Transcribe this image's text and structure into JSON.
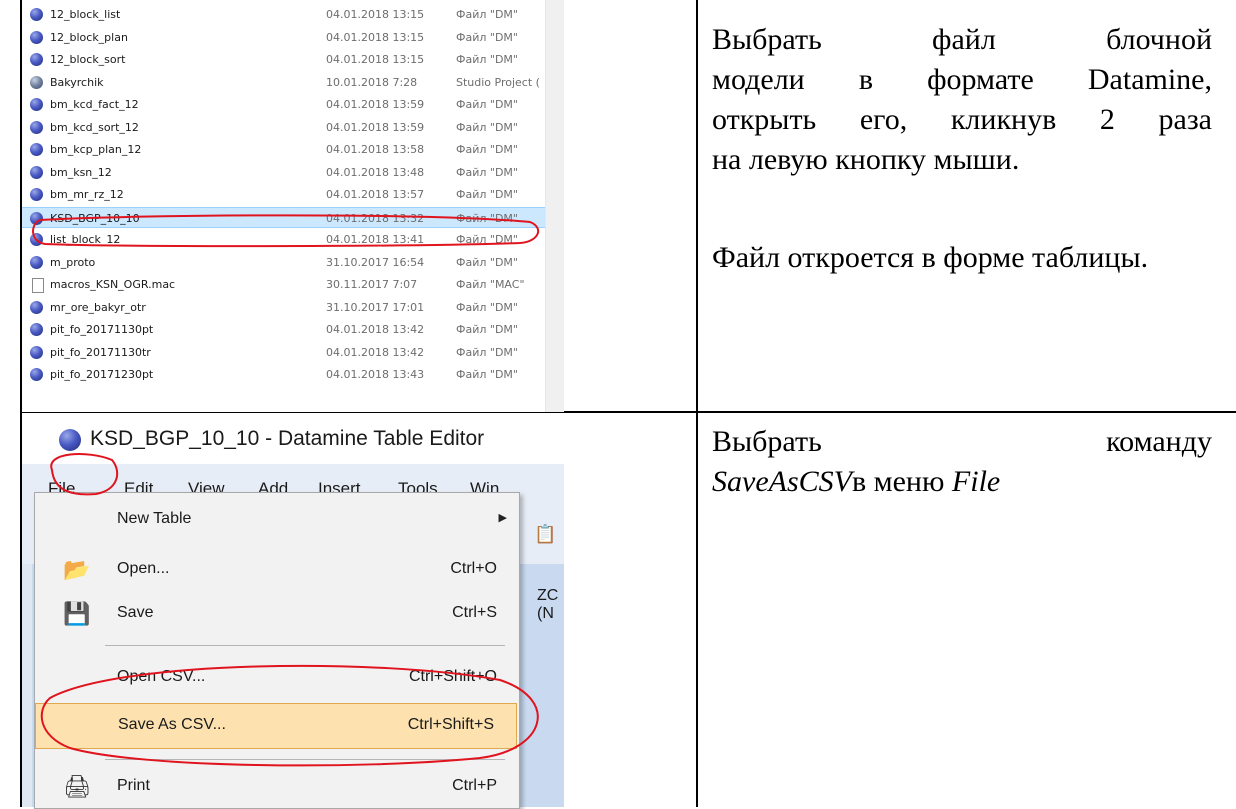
{
  "explorer": {
    "files": [
      {
        "name": "12_block_list",
        "date": "04.01.2018 13:15",
        "type": "Файл \"DM\"",
        "icon": "dm-file-icon"
      },
      {
        "name": "12_block_plan",
        "date": "04.01.2018 13:15",
        "type": "Файл \"DM\"",
        "icon": "dm-file-icon"
      },
      {
        "name": "12_block_sort",
        "date": "04.01.2018 13:15",
        "type": "Файл \"DM\"",
        "icon": "dm-file-icon"
      },
      {
        "name": "Bakyrchik",
        "date": "10.01.2018 7:28",
        "type": "Studio Project (",
        "icon": "studio-project-icon"
      },
      {
        "name": "bm_kcd_fact_12",
        "date": "04.01.2018 13:59",
        "type": "Файл \"DM\"",
        "icon": "dm-file-icon"
      },
      {
        "name": "bm_kcd_sort_12",
        "date": "04.01.2018 13:59",
        "type": "Файл \"DM\"",
        "icon": "dm-file-icon"
      },
      {
        "name": "bm_kcp_plan_12",
        "date": "04.01.2018 13:58",
        "type": "Файл \"DM\"",
        "icon": "dm-file-icon"
      },
      {
        "name": "bm_ksn_12",
        "date": "04.01.2018 13:48",
        "type": "Файл \"DM\"",
        "icon": "dm-file-icon"
      },
      {
        "name": "bm_mr_rz_12",
        "date": "04.01.2018 13:57",
        "type": "Файл \"DM\"",
        "icon": "dm-file-icon"
      },
      {
        "name": "KSD_BGP_10_10",
        "date": "04.01.2018 13:32",
        "type": "Файл \"DM\"",
        "icon": "dm-file-icon",
        "selected": true
      },
      {
        "name": "list_block_12",
        "date": "04.01.2018 13:41",
        "type": "Файл \"DM\"",
        "icon": "dm-file-icon"
      },
      {
        "name": "m_proto",
        "date": "31.10.2017 16:54",
        "type": "Файл \"DM\"",
        "icon": "dm-file-icon"
      },
      {
        "name": "macros_KSN_OGR.mac",
        "date": "30.11.2017 7:07",
        "type": "Файл \"MAC\"",
        "icon": "document-icon"
      },
      {
        "name": "mr_ore_bakyr_otr",
        "date": "31.10.2017 17:01",
        "type": "Файл \"DM\"",
        "icon": "dm-file-icon"
      },
      {
        "name": "pit_fo_20171130pt",
        "date": "04.01.2018 13:42",
        "type": "Файл \"DM\"",
        "icon": "dm-file-icon"
      },
      {
        "name": "pit_fo_20171130tr",
        "date": "04.01.2018 13:42",
        "type": "Файл \"DM\"",
        "icon": "dm-file-icon"
      },
      {
        "name": "pit_fo_20171230pt",
        "date": "04.01.2018 13:43",
        "type": "Файл \"DM\"",
        "icon": "dm-file-icon"
      }
    ]
  },
  "editor": {
    "title": "KSD_BGP_10_10 - Datamine Table Editor",
    "menu": [
      "File",
      "Edit",
      "View",
      "Add",
      "Insert",
      "Tools",
      "Win"
    ],
    "column_header": "ZC (N",
    "file_menu": [
      {
        "label": "New Table",
        "shortcut": "",
        "icon": "",
        "submenu": true
      },
      {
        "label": "Open...",
        "shortcut": "Ctrl+O",
        "icon": "open-folder-icon"
      },
      {
        "label": "Save",
        "shortcut": "Ctrl+S",
        "icon": "save-disk-icon"
      },
      {
        "label": "Open CSV...",
        "shortcut": "Ctrl+Shift+O",
        "icon": ""
      },
      {
        "label": "Save As CSV...",
        "shortcut": "Ctrl+Shift+S",
        "icon": "",
        "highlighted": true
      },
      {
        "label": "Print",
        "shortcut": "Ctrl+P",
        "icon": "printer-icon"
      }
    ]
  },
  "instructions": {
    "step1_lines": [
      "Выбрать файл блочной",
      "модели в формате Datamine,",
      "открыть его, кликнув 2 раза",
      "на левую кнопку мыши."
    ],
    "step1_note": "Файл откроется в форме таблицы.",
    "step2_line1": "Выбрать команду",
    "step2_cmd": "SaveAsCSV",
    "step2_mid": "в меню ",
    "step2_menu": "File"
  },
  "colors": {
    "selection": "#cce8ff",
    "annotation": "#e0141e",
    "menu_highlight": "#fde2b0"
  }
}
